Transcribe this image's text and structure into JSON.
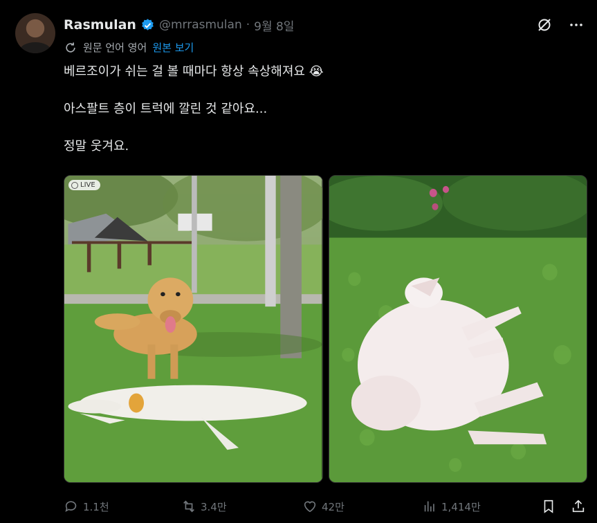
{
  "author": {
    "name": "Rasmulan",
    "handle": "@mrrasmulan",
    "separator": "·",
    "date": "9월 8일"
  },
  "translation": {
    "label": "원문 언어 영어",
    "link": "원본 보기"
  },
  "post": {
    "line1": "베르조이가 쉬는 걸 볼 때마다 항상 속상해져요 😭",
    "line2": "아스팔트 층이 트럭에 깔린 것 같아요...",
    "line3": "정말 웃겨요."
  },
  "media": {
    "live_label": "LIVE"
  },
  "actions": {
    "replies": "1.1천",
    "reposts": "3.4만",
    "likes": "42만",
    "views": "1,414만"
  },
  "colors": {
    "background": "#000000",
    "text": "#e7e9ea",
    "muted": "#71767b",
    "link": "#1d9bf0",
    "verified": "#1d9bf0"
  }
}
